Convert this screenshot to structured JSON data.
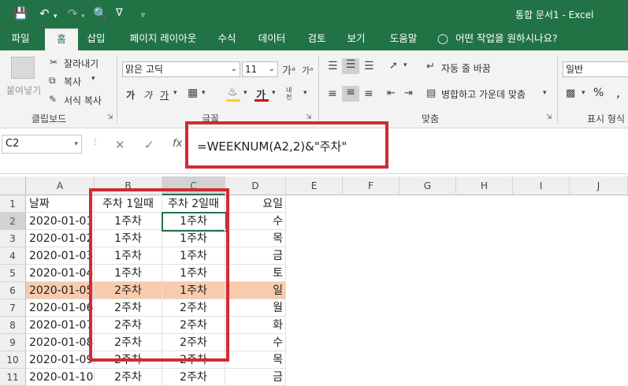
{
  "title_bar": {
    "title": "통합 문서1 - Excel"
  },
  "quick_access": {
    "icons": [
      "save-icon",
      "undo-icon",
      "redo-icon",
      "print-preview-icon",
      "custom-icon",
      "dropdown-icon"
    ]
  },
  "tabs": [
    {
      "label": "파일"
    },
    {
      "label": "홈"
    },
    {
      "label": "삽입"
    },
    {
      "label": "페이지 레이아웃"
    },
    {
      "label": "수식"
    },
    {
      "label": "데이터"
    },
    {
      "label": "검토"
    },
    {
      "label": "보기"
    },
    {
      "label": "도움말"
    },
    {
      "label": "어떤 작업을 원하시나요?"
    }
  ],
  "ribbon": {
    "clipboard": {
      "paste": "붙여넣기",
      "cut": "잘라내기",
      "copy": "복사",
      "format_painter": "서식 복사",
      "group_label": "클립보드"
    },
    "font": {
      "font_name": "맑은 고딕",
      "font_size": "11",
      "bold": "가",
      "italic": "가",
      "underline": "가",
      "font_color_glyph": "가",
      "phonetic": "내천",
      "group_label": "글꼴"
    },
    "alignment": {
      "wrap_text": "자동 줄 바꿈",
      "merge_center": "병합하고 가운데 맞춤",
      "group_label": "맞춤"
    },
    "number": {
      "format": "일반",
      "percent": "%",
      "comma": ",",
      "group_label": "표시 형식"
    }
  },
  "formula_bar": {
    "name_box": "C2",
    "fx": "fx",
    "formula": "=WEEKNUM(A2,2)&\"주차\""
  },
  "sheet": {
    "column_headers": [
      "A",
      "B",
      "C",
      "D",
      "E",
      "F",
      "G",
      "H",
      "I",
      "J"
    ],
    "row_headers": [
      "1",
      "2",
      "3",
      "4",
      "5",
      "6",
      "7",
      "8",
      "9",
      "10",
      "11"
    ],
    "header_row": {
      "a": "날짜",
      "b": "주차 1일때",
      "c": "주차 2일때",
      "d": "요일"
    },
    "rows": [
      {
        "a": "2020-01-01",
        "b": "1주차",
        "c": "1주차",
        "d": "수"
      },
      {
        "a": "2020-01-02",
        "b": "1주차",
        "c": "1주차",
        "d": "목"
      },
      {
        "a": "2020-01-03",
        "b": "1주차",
        "c": "1주차",
        "d": "금"
      },
      {
        "a": "2020-01-04",
        "b": "1주차",
        "c": "1주차",
        "d": "토"
      },
      {
        "a": "2020-01-05",
        "b": "2주차",
        "c": "1주차",
        "d": "일"
      },
      {
        "a": "2020-01-06",
        "b": "2주차",
        "c": "2주차",
        "d": "월"
      },
      {
        "a": "2020-01-07",
        "b": "2주차",
        "c": "2주차",
        "d": "화"
      },
      {
        "a": "2020-01-08",
        "b": "2주차",
        "c": "2주차",
        "d": "수"
      },
      {
        "a": "2020-01-09",
        "b": "2주차",
        "c": "2주차",
        "d": "목"
      },
      {
        "a": "2020-01-10",
        "b": "2주차",
        "c": "2주차",
        "d": "금"
      }
    ],
    "highlight_fill": "#f8cbad",
    "active_cell": "C2"
  },
  "colors": {
    "excel_green": "#217346",
    "annotation_red": "#d22a35"
  }
}
